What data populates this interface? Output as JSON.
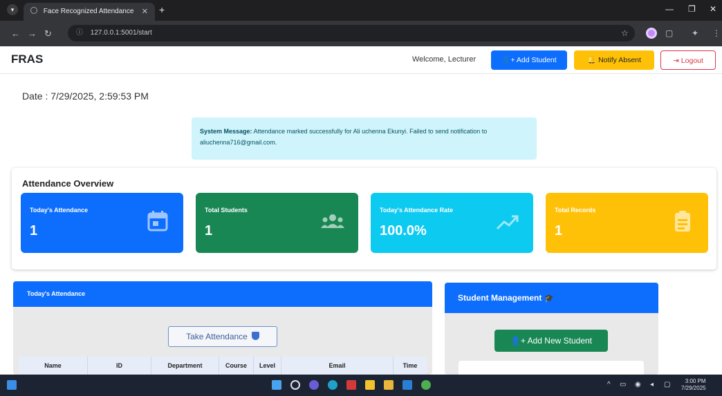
{
  "browser": {
    "tab_title": "Face Recognized Attendance",
    "url": "127.0.0.1:5001/start"
  },
  "navbar": {
    "brand": "FRAS",
    "welcome": "Welcome, Lecturer",
    "add_student": "Add Student",
    "notify_absent": "Notify Absent",
    "logout": "Logout"
  },
  "date_line": "Date : 7/29/2025, 2:59:53 PM",
  "system_message": {
    "label": "System Message:",
    "text": " Attendance marked successfully for Ali uchenna Ekunyi. Failed to send notification to aliuchenna716@gmail.com."
  },
  "overview": {
    "title": "Attendance Overview",
    "cards": [
      {
        "label": "Today's Attendance",
        "value": "1",
        "icon": "calendar-icon",
        "color": "#0d6efd"
      },
      {
        "label": "Total Students",
        "value": "1",
        "icon": "users-icon",
        "color": "#198754"
      },
      {
        "label": "Today's Attendance Rate",
        "value": "100.0%",
        "icon": "trend-up-icon",
        "color": "#0dcaf0"
      },
      {
        "label": "Total Records",
        "value": "1",
        "icon": "clipboard-icon",
        "color": "#ffc107"
      }
    ]
  },
  "today_attendance": {
    "title": "Today's Attendance",
    "take_button": "Take Attendance",
    "columns": [
      "Name",
      "ID",
      "Department",
      "Course",
      "Level",
      "Email",
      "Time"
    ]
  },
  "student_management": {
    "title": "Student Management",
    "add_button": "Add New Student"
  },
  "taskbar": {
    "time": "3:00 PM",
    "date": "7/29/2025"
  }
}
